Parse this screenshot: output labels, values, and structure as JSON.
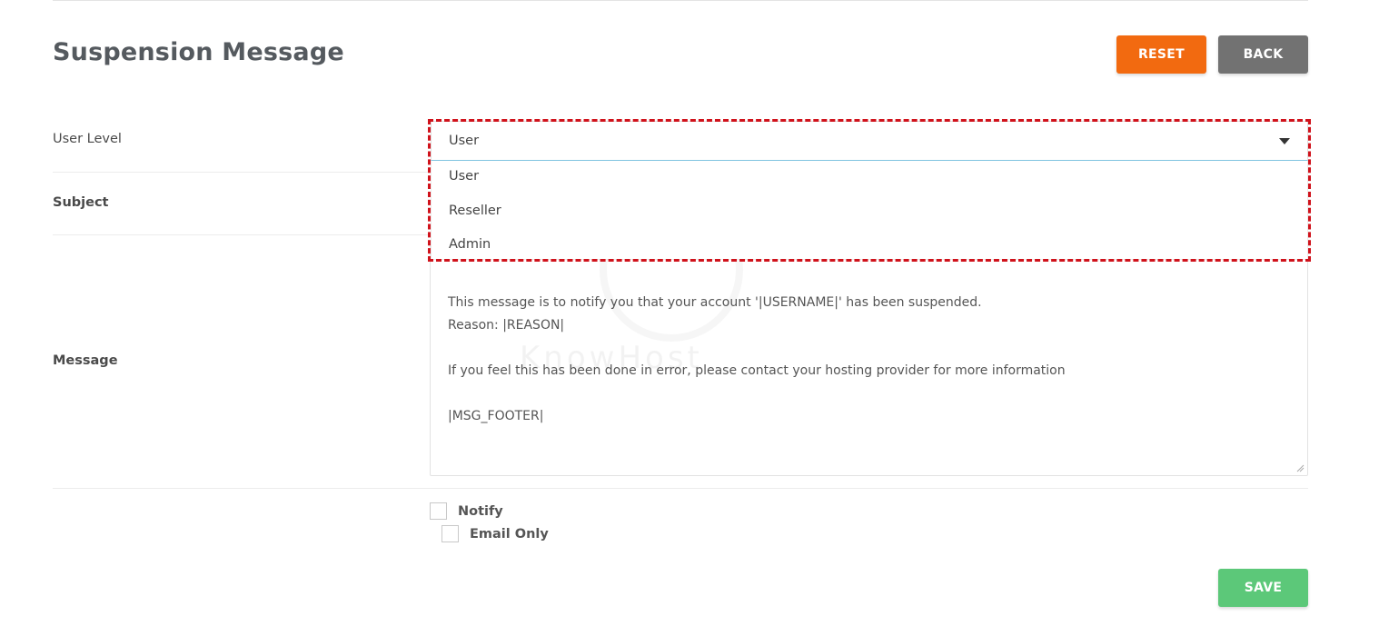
{
  "page": {
    "title": "Suspension Message"
  },
  "toolbar": {
    "reset_label": "RESET",
    "back_label": "BACK",
    "save_label": "SAVE"
  },
  "form": {
    "user_level": {
      "label": "User Level",
      "selected": "User",
      "options": [
        "User",
        "Reseller",
        "Admin"
      ]
    },
    "subject": {
      "label": "Subject"
    },
    "message": {
      "label": "Message",
      "lines": [
        "This message is to notify you that your account '|USERNAME|' has been suspended.",
        "Reason: |REASON|",
        "",
        "If you feel this has been done in error, please contact your hosting provider for more information",
        "",
        "|MSG_FOOTER|"
      ]
    },
    "notify": {
      "label": "Notify",
      "checked": false
    },
    "email_only": {
      "label": "Email Only",
      "checked": false
    }
  },
  "watermark": {
    "text": "KnowHost",
    "icon": "kh-logo-icon"
  },
  "colors": {
    "reset": "#f26a10",
    "back": "#727272",
    "save": "#5cc879",
    "highlight": "#d0121b",
    "select_focus": "#7fc4e0"
  }
}
